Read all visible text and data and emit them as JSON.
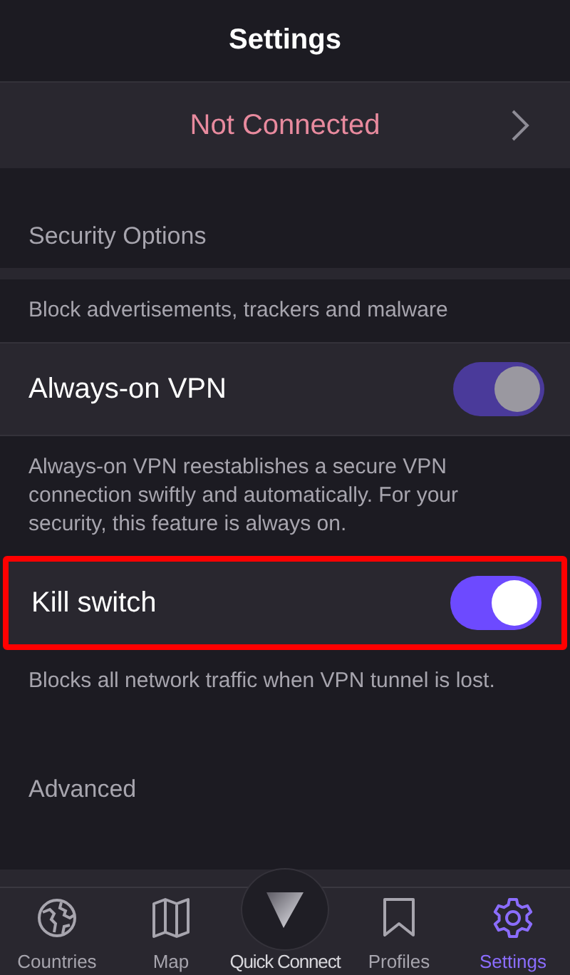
{
  "header": {
    "title": "Settings"
  },
  "connection": {
    "status": "Not Connected",
    "connected": false
  },
  "sections": [
    {
      "kind": "section",
      "title": "Security Options"
    },
    {
      "kind": "note",
      "text": "Block advertisements, trackers and malware"
    },
    {
      "kind": "toggle",
      "label": "Always-on VPN",
      "on": true,
      "disabled": true,
      "highlighted": false
    },
    {
      "kind": "note",
      "text": "Always-on VPN reestablishes a secure VPN connection swiftly and automatically. For your security, this feature is always on."
    },
    {
      "kind": "toggle",
      "label": "Kill switch",
      "on": true,
      "disabled": false,
      "highlighted": true
    },
    {
      "kind": "note",
      "text": "Blocks all network traffic when VPN tunnel is lost."
    },
    {
      "kind": "section",
      "title": "Advanced"
    }
  ],
  "tabs": [
    {
      "kind": "globe",
      "label": "Countries",
      "selected": false
    },
    {
      "kind": "map",
      "label": "Map",
      "selected": false
    },
    {
      "kind": "quick",
      "label": "Quick Connect",
      "selected": false
    },
    {
      "kind": "bookmark",
      "label": "Profiles",
      "selected": false
    },
    {
      "kind": "gear",
      "label": "Settings",
      "selected": true
    }
  ]
}
